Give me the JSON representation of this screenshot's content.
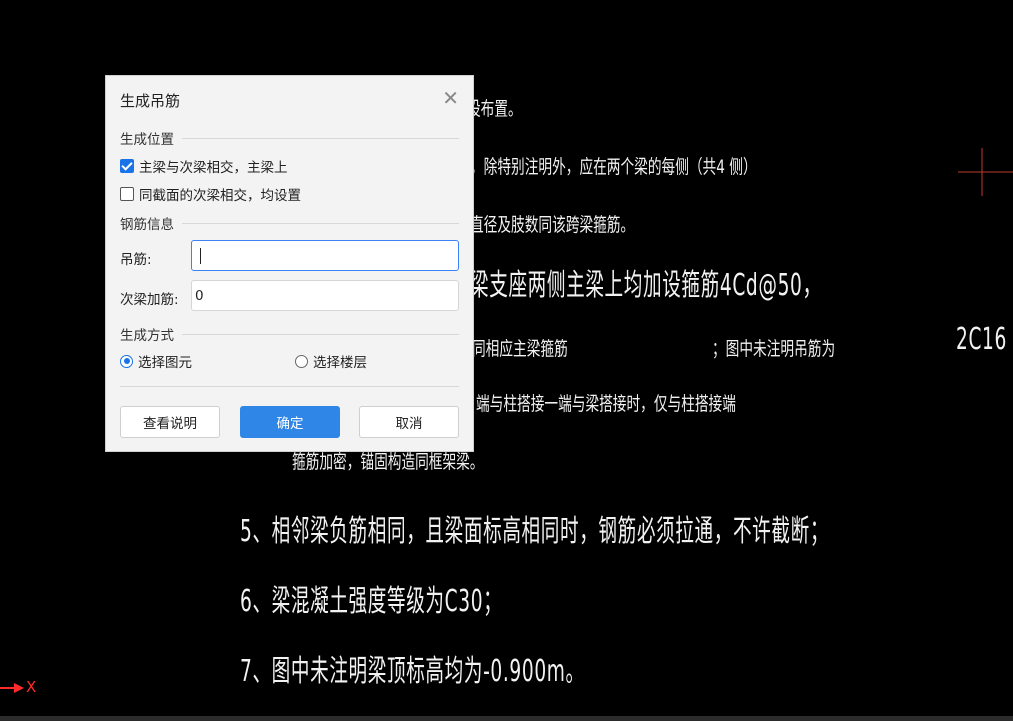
{
  "dialog": {
    "title": "生成吊筋",
    "section_position": "生成位置",
    "option_main_secondary": "主梁与次梁相交，主梁上",
    "option_main_secondary_checked": true,
    "option_same_section": "同截面的次梁相交，均设置",
    "option_same_section_checked": false,
    "section_rebar": "钢筋信息",
    "hanger_label": "吊筋:",
    "hanger_value": "",
    "secondary_rebar_label": "次梁加筋:",
    "secondary_rebar_value": "0",
    "section_method": "生成方式",
    "method_select_element": "选择图元",
    "method_select_floor": "选择楼层",
    "method_selected": "选择图元",
    "btn_help": "查看说明",
    "btn_ok": "确定",
    "btn_cancel": "取消"
  },
  "cad": {
    "line1": "设布置。",
    "line2": "，除特别注明外，应在两个梁的每侧（共4 侧）",
    "line3": "直径及肢数同该跨梁箍筋。",
    "line4": "梁支座两侧主梁上均加设箍筋4Cd@50，",
    "line5a": "同相应主梁箍筋",
    "line5b": "；图中未注明吊筋为",
    "line5c": "2C16",
    "line6": "端与柱搭接一端与梁搭接时，仅与柱搭接端",
    "line7": "箍筋加密，锚固构造同框架梁。",
    "line8": "5、相邻梁负筋相同，且梁面标高相同时，钢筋必须拉通，不许截断；",
    "line9": "6、梁混凝土强度等级为C30；",
    "line10": "7、图中未注明梁顶标高均为-0.900m。",
    "axis_x": "X"
  },
  "colors": {
    "cad_background": "#000000",
    "cad_text": "#f2f2f2",
    "crosshair": "#c0392b",
    "axis": "#ff2a2a",
    "primary_button": "#2f86e6"
  }
}
